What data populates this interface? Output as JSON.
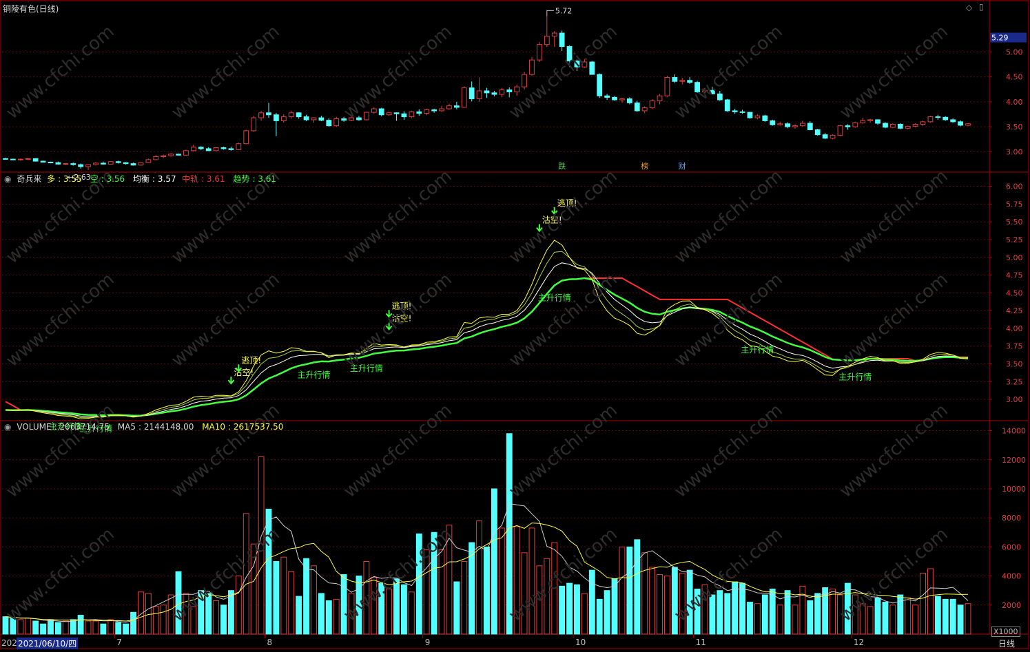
{
  "window": {
    "title": "铜陵有色(日线)",
    "period": "日线",
    "scale_unit": "X1000",
    "cursor_date": "2021/06/10/四",
    "cursor_date_prefix": "202",
    "colors": {
      "background": "#000000",
      "border": "#b00000",
      "up": "#e04040",
      "down": "#54ffff",
      "grid": "#5a1010"
    }
  },
  "price_panel": {
    "current_price_label": "5.29",
    "high_marker": "5.72",
    "low_marker": "2.63",
    "y_ticks": [
      "5.00",
      "4.50",
      "4.00",
      "3.50",
      "3.00"
    ],
    "event_tags": [
      {
        "label": "跌",
        "color": "#40e040"
      },
      {
        "label": "榜",
        "color": "#e8a020"
      },
      {
        "label": "财",
        "color": "#5aa0ff"
      }
    ]
  },
  "indicator_panel": {
    "name": "奇兵来",
    "items": [
      {
        "key": "多",
        "value": "3.55",
        "color": "#ffff40"
      },
      {
        "key": "空",
        "value": "3.56",
        "color": "#40ff40"
      },
      {
        "key": "均衡",
        "value": "3.57",
        "color": "#ffffff"
      },
      {
        "key": "中轨",
        "value": "3.61",
        "color": "#ff3030"
      },
      {
        "key": "趋势",
        "value": "3.61",
        "color": "#40ff40"
      }
    ],
    "y_ticks": [
      "6.00",
      "5.75",
      "5.50",
      "5.25",
      "5.00",
      "4.75",
      "4.50",
      "4.25",
      "4.00",
      "3.75",
      "3.50",
      "3.25",
      "3.00"
    ],
    "signals": {
      "uptrend_label": "主升行情",
      "escape_top_label": "逃顶!",
      "short_label": "沽空!"
    }
  },
  "volume_panel": {
    "name": "VOLUME",
    "items": [
      {
        "key": "VOLUME",
        "value": "2063714.75",
        "color": "#d0d0d0"
      },
      {
        "key": "MA5",
        "value": "2144148.00",
        "color": "#d0d0d0"
      },
      {
        "key": "MA10",
        "value": "2617537.50",
        "color": "#ffff40"
      }
    ],
    "y_ticks": [
      "14000",
      "12000",
      "10000",
      "8000",
      "6000",
      "4000",
      "2000"
    ]
  },
  "x_axis": {
    "month_labels": [
      "7",
      "8",
      "9",
      "10",
      "11",
      "12"
    ]
  },
  "chart_data": {
    "type": "candlestick",
    "title": "铜陵有色(日线)",
    "price_ylim": [
      2.7,
      5.85
    ],
    "indicator_ylim": [
      2.7,
      6.2
    ],
    "volume_ylim": [
      0,
      14500
    ],
    "volume_unit": "X1000",
    "month_start_index": {
      "7": 15,
      "8": 35,
      "9": 56,
      "10": 76,
      "11": 92,
      "12": 113
    },
    "candles": [
      [
        2.86,
        2.88,
        2.84,
        2.85
      ],
      [
        2.85,
        2.86,
        2.83,
        2.84
      ],
      [
        2.84,
        2.86,
        2.82,
        2.85
      ],
      [
        2.85,
        2.87,
        2.83,
        2.86
      ],
      [
        2.86,
        2.87,
        2.8,
        2.81
      ],
      [
        2.81,
        2.82,
        2.78,
        2.79
      ],
      [
        2.79,
        2.8,
        2.77,
        2.78
      ],
      [
        2.78,
        2.8,
        2.74,
        2.75
      ],
      [
        2.75,
        2.77,
        2.73,
        2.76
      ],
      [
        2.76,
        2.78,
        2.72,
        2.74
      ],
      [
        2.74,
        2.76,
        2.66,
        2.7
      ],
      [
        2.7,
        2.75,
        2.63,
        2.74
      ],
      [
        2.74,
        2.79,
        2.72,
        2.77
      ],
      [
        2.77,
        2.8,
        2.74,
        2.75
      ],
      [
        2.75,
        2.81,
        2.74,
        2.8
      ],
      [
        2.8,
        2.82,
        2.76,
        2.78
      ],
      [
        2.78,
        2.79,
        2.74,
        2.76
      ],
      [
        2.76,
        2.78,
        2.72,
        2.73
      ],
      [
        2.73,
        2.79,
        2.72,
        2.78
      ],
      [
        2.78,
        2.86,
        2.77,
        2.84
      ],
      [
        2.84,
        2.93,
        2.83,
        2.9
      ],
      [
        2.9,
        2.94,
        2.88,
        2.92
      ],
      [
        2.92,
        2.97,
        2.9,
        2.95
      ],
      [
        2.95,
        2.96,
        2.92,
        2.93
      ],
      [
        2.93,
        3.04,
        2.92,
        3.02
      ],
      [
        3.02,
        3.14,
        3.0,
        3.09
      ],
      [
        3.09,
        3.11,
        3.03,
        3.06
      ],
      [
        3.06,
        3.09,
        3.01,
        3.02
      ],
      [
        3.02,
        3.09,
        3.01,
        3.08
      ],
      [
        3.08,
        3.1,
        3.04,
        3.06
      ],
      [
        3.06,
        3.1,
        3.02,
        3.04
      ],
      [
        3.04,
        3.18,
        3.03,
        3.16
      ],
      [
        3.16,
        3.44,
        3.15,
        3.42
      ],
      [
        3.42,
        3.72,
        3.4,
        3.68
      ],
      [
        3.68,
        3.82,
        3.62,
        3.78
      ],
      [
        3.78,
        3.98,
        3.68,
        3.74
      ],
      [
        3.74,
        3.78,
        3.31,
        3.62
      ],
      [
        3.62,
        3.75,
        3.58,
        3.7
      ],
      [
        3.7,
        3.82,
        3.66,
        3.78
      ],
      [
        3.78,
        3.79,
        3.66,
        3.7
      ],
      [
        3.7,
        3.74,
        3.61,
        3.64
      ],
      [
        3.64,
        3.69,
        3.58,
        3.68
      ],
      [
        3.68,
        3.72,
        3.61,
        3.63
      ],
      [
        3.63,
        3.67,
        3.5,
        3.52
      ],
      [
        3.52,
        3.7,
        3.5,
        3.66
      ],
      [
        3.66,
        3.7,
        3.6,
        3.63
      ],
      [
        3.63,
        3.7,
        3.61,
        3.68
      ],
      [
        3.68,
        3.72,
        3.62,
        3.64
      ],
      [
        3.64,
        3.8,
        3.63,
        3.79
      ],
      [
        3.79,
        3.89,
        3.76,
        3.86
      ],
      [
        3.86,
        3.88,
        3.71,
        3.74
      ],
      [
        3.74,
        3.8,
        3.72,
        3.78
      ],
      [
        3.78,
        3.79,
        3.62,
        3.76
      ],
      [
        3.76,
        3.81,
        3.64,
        3.7
      ],
      [
        3.7,
        3.82,
        3.67,
        3.8
      ],
      [
        3.8,
        3.85,
        3.72,
        3.77
      ],
      [
        3.77,
        3.86,
        3.73,
        3.84
      ],
      [
        3.84,
        3.86,
        3.78,
        3.82
      ],
      [
        3.82,
        3.92,
        3.8,
        3.86
      ],
      [
        3.86,
        3.96,
        3.84,
        3.92
      ],
      [
        3.92,
        4.0,
        3.85,
        3.89
      ],
      [
        3.89,
        4.31,
        3.88,
        4.28
      ],
      [
        4.28,
        4.41,
        4.01,
        4.06
      ],
      [
        4.06,
        4.49,
        4.0,
        4.22
      ],
      [
        4.22,
        4.28,
        4.08,
        4.18
      ],
      [
        4.18,
        4.22,
        4.11,
        4.15
      ],
      [
        4.15,
        4.28,
        4.09,
        4.24
      ],
      [
        4.24,
        4.29,
        4.09,
        4.2
      ],
      [
        4.2,
        4.35,
        4.12,
        4.3
      ],
      [
        4.3,
        4.6,
        4.25,
        4.55
      ],
      [
        4.55,
        4.9,
        4.52,
        4.84
      ],
      [
        4.84,
        5.2,
        4.8,
        5.15
      ],
      [
        5.15,
        5.72,
        5.1,
        5.32
      ],
      [
        5.32,
        5.42,
        5.1,
        5.38
      ],
      [
        5.38,
        5.43,
        5.02,
        5.11
      ],
      [
        5.11,
        5.13,
        4.7,
        4.82
      ],
      [
        4.82,
        4.85,
        4.62,
        4.7
      ],
      [
        4.7,
        4.86,
        4.68,
        4.8
      ],
      [
        4.8,
        4.82,
        4.55,
        4.55
      ],
      [
        4.55,
        4.57,
        4.08,
        4.12
      ],
      [
        4.12,
        4.16,
        4.04,
        4.09
      ],
      [
        4.09,
        4.12,
        4.02,
        4.04
      ],
      [
        4.04,
        4.08,
        3.98,
        4.06
      ],
      [
        4.06,
        4.09,
        3.95,
        3.98
      ],
      [
        3.98,
        4.02,
        3.8,
        3.82
      ],
      [
        3.82,
        3.91,
        3.77,
        3.88
      ],
      [
        3.88,
        4.05,
        3.86,
        4.02
      ],
      [
        4.02,
        4.16,
        3.95,
        4.12
      ],
      [
        4.12,
        4.52,
        4.1,
        4.49
      ],
      [
        4.49,
        4.55,
        4.38,
        4.41
      ],
      [
        4.41,
        4.48,
        4.35,
        4.43
      ],
      [
        4.43,
        4.5,
        4.36,
        4.39
      ],
      [
        4.39,
        4.42,
        4.18,
        4.2
      ],
      [
        4.2,
        4.28,
        4.13,
        4.23
      ],
      [
        4.23,
        4.3,
        4.15,
        4.16
      ],
      [
        4.16,
        4.22,
        4.02,
        4.04
      ],
      [
        4.04,
        4.06,
        3.8,
        3.82
      ],
      [
        3.82,
        3.86,
        3.76,
        3.8
      ],
      [
        3.8,
        3.84,
        3.76,
        3.79
      ],
      [
        3.79,
        3.8,
        3.66,
        3.68
      ],
      [
        3.68,
        3.75,
        3.65,
        3.72
      ],
      [
        3.72,
        3.74,
        3.6,
        3.62
      ],
      [
        3.62,
        3.64,
        3.52,
        3.54
      ],
      [
        3.54,
        3.6,
        3.52,
        3.56
      ],
      [
        3.56,
        3.59,
        3.47,
        3.5
      ],
      [
        3.5,
        3.55,
        3.46,
        3.52
      ],
      [
        3.52,
        3.62,
        3.5,
        3.57
      ],
      [
        3.57,
        3.61,
        3.43,
        3.44
      ],
      [
        3.44,
        3.46,
        3.32,
        3.34
      ],
      [
        3.34,
        3.38,
        3.25,
        3.27
      ],
      [
        3.27,
        3.35,
        3.25,
        3.33
      ],
      [
        3.33,
        3.54,
        3.31,
        3.52
      ],
      [
        3.52,
        3.55,
        3.44,
        3.5
      ],
      [
        3.5,
        3.6,
        3.48,
        3.58
      ],
      [
        3.58,
        3.68,
        3.56,
        3.62
      ],
      [
        3.62,
        3.66,
        3.58,
        3.64
      ],
      [
        3.64,
        3.65,
        3.54,
        3.57
      ],
      [
        3.57,
        3.59,
        3.47,
        3.49
      ],
      [
        3.49,
        3.57,
        3.47,
        3.55
      ],
      [
        3.55,
        3.57,
        3.45,
        3.47
      ],
      [
        3.47,
        3.52,
        3.45,
        3.51
      ],
      [
        3.51,
        3.57,
        3.49,
        3.55
      ],
      [
        3.55,
        3.62,
        3.52,
        3.6
      ],
      [
        3.6,
        3.72,
        3.58,
        3.7
      ],
      [
        3.7,
        3.74,
        3.64,
        3.69
      ],
      [
        3.69,
        3.71,
        3.62,
        3.64
      ],
      [
        3.64,
        3.67,
        3.58,
        3.6
      ],
      [
        3.6,
        3.63,
        3.51,
        3.53
      ],
      [
        3.53,
        3.57,
        3.51,
        3.56
      ]
    ],
    "volume": [
      1200,
      1100,
      1000,
      1100,
      900,
      700,
      1000,
      800,
      900,
      1000,
      1300,
      900,
      900,
      700,
      1000,
      800,
      700,
      1500,
      2900,
      2800,
      1900,
      2000,
      2700,
      4300,
      2800,
      1900,
      3000,
      2800,
      2300,
      2000,
      3000,
      4000,
      8300,
      6200,
      12200,
      8600,
      5000,
      5300,
      4300,
      2600,
      5200,
      4700,
      2800,
      2300,
      2400,
      4100,
      2800,
      4000,
      5000,
      3900,
      3500,
      3100,
      3800,
      3400,
      2900,
      6900,
      5800,
      7000,
      5800,
      7500,
      3600,
      5000,
      6300,
      7800,
      6000,
      10000,
      7300,
      13800,
      7400,
      5600,
      7300,
      4700,
      5200,
      6300,
      3300,
      3500,
      3400,
      2800,
      4400,
      2400,
      3000,
      3800,
      6000,
      6000,
      6500,
      5600,
      4600,
      4100,
      4000,
      4600,
      4200,
      4400,
      3100,
      3400,
      2700,
      3000,
      2800,
      3600,
      3500,
      2200,
      2100,
      2700,
      3100,
      2000,
      3000,
      2000,
      3300,
      2300,
      2800,
      3200,
      3100,
      2700,
      3500,
      2700,
      2100,
      1900,
      2500,
      2200,
      2000,
      2700,
      2500,
      2000,
      4200,
      4500,
      2600,
      2400,
      2400,
      2000,
      2100
    ],
    "indicator_lines": [
      {
        "name": "多",
        "color": "#ffff40"
      },
      {
        "name": "空",
        "color": "#40ff40"
      },
      {
        "name": "均衡",
        "color": "#ffffff"
      },
      {
        "name": "中轨",
        "color": "#ff3030"
      },
      {
        "name": "趋势",
        "color": "#40ff40"
      }
    ],
    "volume_lines": [
      {
        "name": "MA5",
        "color": "#d0d0d0"
      },
      {
        "name": "MA10",
        "color": "#ffff40"
      }
    ]
  }
}
